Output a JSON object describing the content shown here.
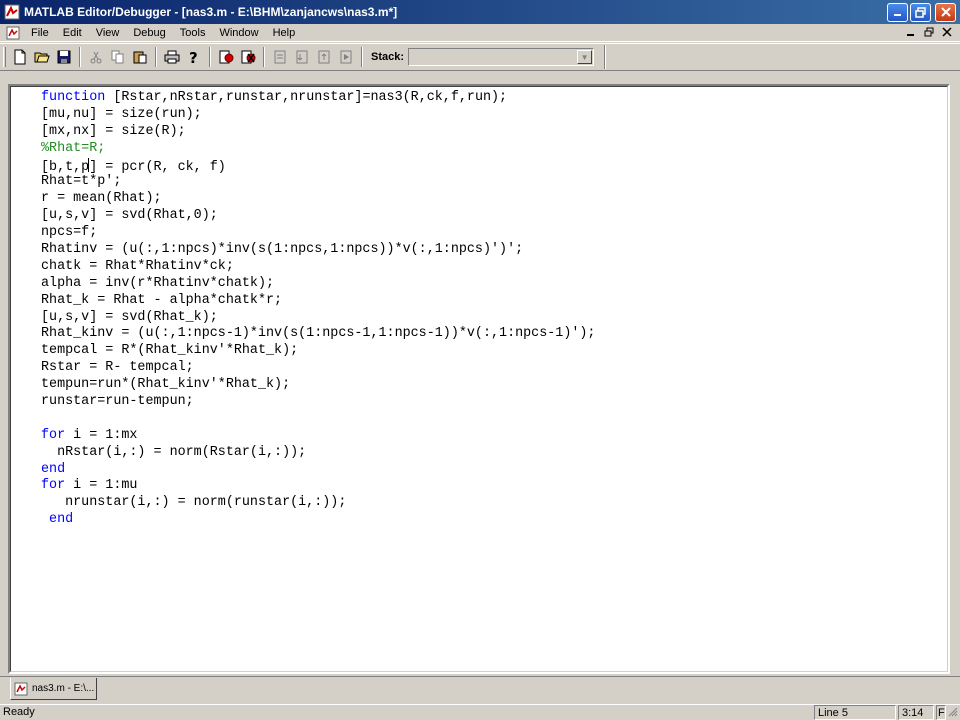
{
  "window": {
    "title": "MATLAB Editor/Debugger - [nas3.m - E:\\BHM\\zanjancws\\nas3.m*]",
    "accent": "#0a246a"
  },
  "menu": {
    "items": [
      "File",
      "Edit",
      "View",
      "Debug",
      "Tools",
      "Window",
      "Help"
    ]
  },
  "toolbar": {
    "icons": [
      "new-file-icon",
      "open-folder-icon",
      "save-icon",
      "cut-icon",
      "copy-icon",
      "paste-icon",
      "print-icon",
      "help-icon",
      "set-breakpoint-icon",
      "clear-breakpoints-icon",
      "step-icon",
      "step-in-icon",
      "step-out-icon",
      "continue-icon"
    ],
    "stack_label": "Stack:",
    "stack_value": ""
  },
  "editor": {
    "lines": [
      [
        {
          "t": "function",
          "c": "kw"
        },
        {
          "t": " [Rstar,nRstar,runstar,nrunstar]=nas3(R,ck,f,run);"
        }
      ],
      [
        {
          "t": "[mu,nu] = size(run);"
        }
      ],
      [
        {
          "t": "[mx,nx] = size(R);"
        }
      ],
      [
        {
          "t": "%Rhat=R;",
          "c": "cm"
        }
      ],
      [
        {
          "t": "[b,t,p"
        },
        {
          "caret": true
        },
        {
          "t": "] = pcr(R, ck, f)"
        }
      ],
      [
        {
          "t": "Rhat=t*p';"
        }
      ],
      [
        {
          "t": "r = mean(Rhat);"
        }
      ],
      [
        {
          "t": "[u,s,v] = svd(Rhat,0);"
        }
      ],
      [
        {
          "t": "npcs=f;"
        }
      ],
      [
        {
          "t": "Rhatinv = (u(:,1:npcs)*inv(s(1:npcs,1:npcs))*v(:,1:npcs)')';"
        }
      ],
      [
        {
          "t": "chatk = Rhat*Rhatinv*ck;"
        }
      ],
      [
        {
          "t": "alpha = inv(r*Rhatinv*chatk);"
        }
      ],
      [
        {
          "t": "Rhat_k = Rhat - alpha*chatk*r;"
        }
      ],
      [
        {
          "t": "[u,s,v] = svd(Rhat_k);"
        }
      ],
      [
        {
          "t": "Rhat_kinv = (u(:,1:npcs-1)*inv(s(1:npcs-1,1:npcs-1))*v(:,1:npcs-1)');"
        }
      ],
      [
        {
          "t": "tempcal = R*(Rhat_kinv'*Rhat_k);"
        }
      ],
      [
        {
          "t": "Rstar = R- tempcal;"
        }
      ],
      [
        {
          "t": "tempun=run*(Rhat_kinv'*Rhat_k);"
        }
      ],
      [
        {
          "t": "runstar=run-tempun;"
        }
      ],
      [
        {
          "t": ""
        }
      ],
      [
        {
          "t": "for",
          "c": "kw"
        },
        {
          "t": " i = 1:mx"
        }
      ],
      [
        {
          "t": "  nRstar(i,:) = norm(Rstar(i,:));"
        }
      ],
      [
        {
          "t": "end",
          "c": "kw"
        }
      ],
      [
        {
          "t": "for",
          "c": "kw"
        },
        {
          "t": " i = 1:mu"
        }
      ],
      [
        {
          "t": "   nrunstar(i,:) = norm(runstar(i,:));"
        }
      ],
      [
        {
          "t": " "
        },
        {
          "t": "end",
          "c": "kw"
        }
      ]
    ]
  },
  "doc_tab": {
    "label": "nas3.m - E:\\..."
  },
  "status": {
    "message": "Ready",
    "line": "Line 5",
    "col": "3:14",
    "flag": "F"
  }
}
